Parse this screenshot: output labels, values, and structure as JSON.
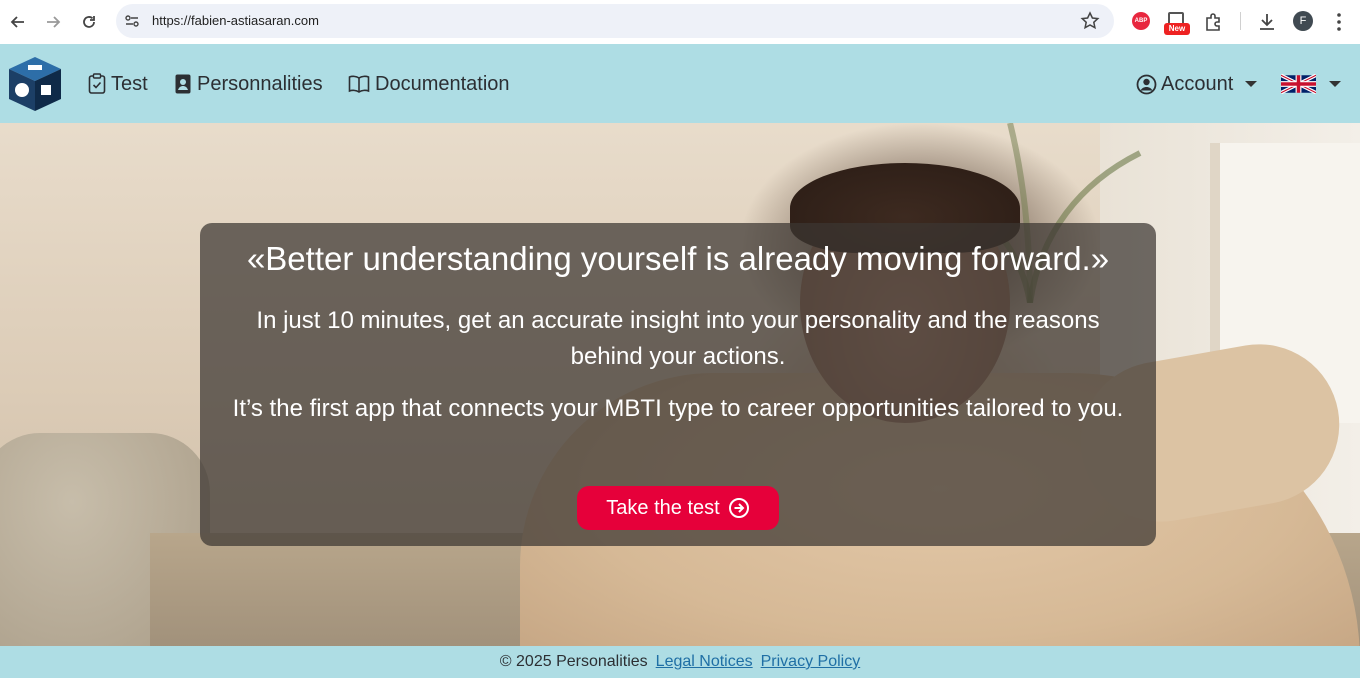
{
  "browser": {
    "url": "https://fabien-astiasaran.com",
    "extensions": {
      "abp_label": "ABP",
      "new_badge": "New"
    },
    "profile_initial": "F"
  },
  "navbar": {
    "links": [
      {
        "label": "Test",
        "icon": "clipboard-check-icon"
      },
      {
        "label": "Personnalities",
        "icon": "person-badge-icon"
      },
      {
        "label": "Documentation",
        "icon": "book-icon"
      }
    ],
    "account_label": "Account",
    "language_flag": "uk-flag-icon"
  },
  "hero": {
    "quote": "«Better understanding yourself is already moving forward.»",
    "paragraph1": "In just 10 minutes, get an accurate insight into your personality and the reasons behind your actions.",
    "paragraph2": "It’s the first app that connects your MBTI type to career opportunities tailored to you.",
    "cta_label": "Take the test"
  },
  "footer": {
    "copyright": "© 2025 Personalities",
    "legal_label": "Legal Notices",
    "privacy_label": "Privacy Policy"
  },
  "colors": {
    "navbar_bg": "#aedde4",
    "cta_bg": "#e6003a",
    "link": "#1f6fa5"
  }
}
